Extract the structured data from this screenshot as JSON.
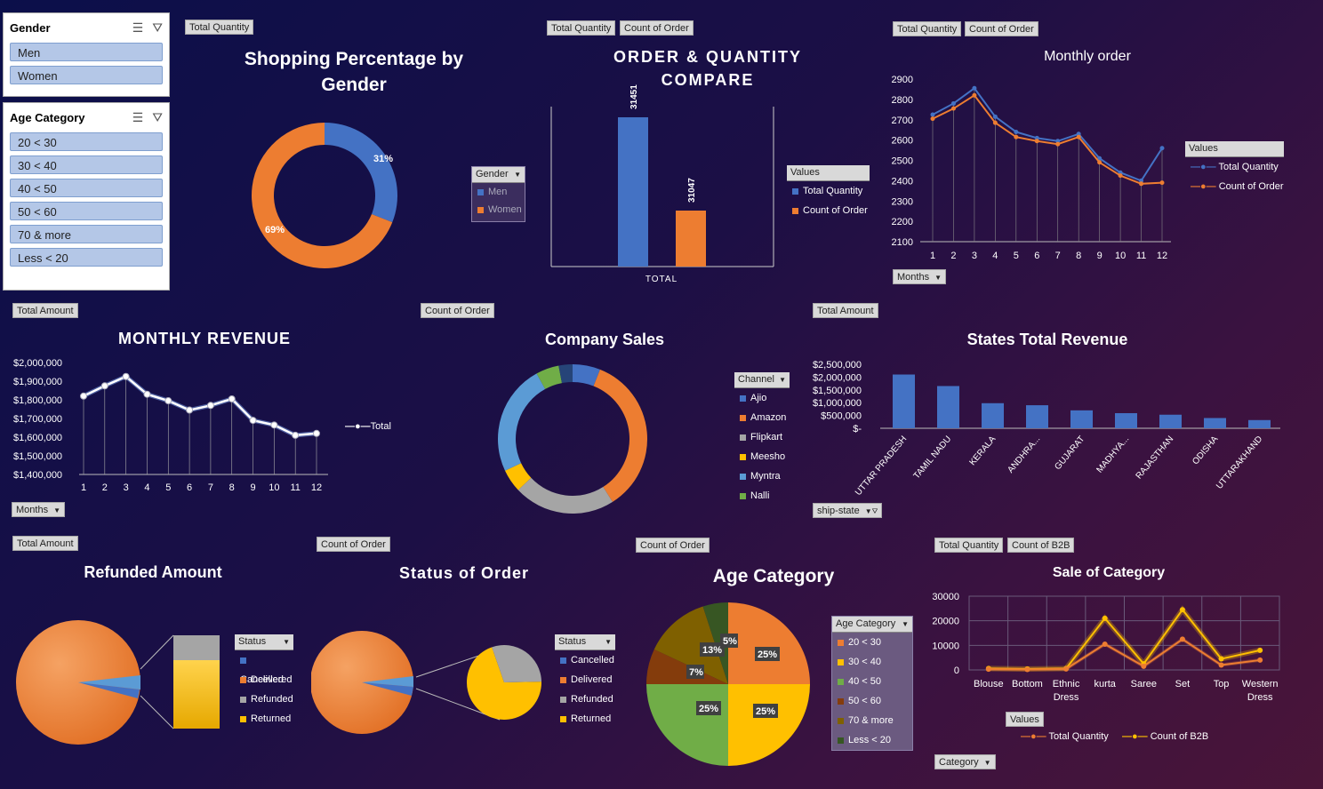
{
  "colors": {
    "blue": "#4472c4",
    "orange": "#ed7d31",
    "gray": "#a5a5a5",
    "yellow": "#ffc000",
    "lightblue": "#5b9bd5",
    "green": "#70ad47",
    "darkgreen": "#375623",
    "brown": "#843c0c",
    "olive": "#7f6000"
  },
  "slicers": {
    "gender": {
      "title": "Gender",
      "items": [
        "Men",
        "Women"
      ]
    },
    "age": {
      "title": "Age Category",
      "items": [
        "20 < 30",
        "30 < 40",
        "40 < 50",
        "50 < 60",
        "70 & more",
        "Less < 20"
      ]
    }
  },
  "gender_chart": {
    "field": "Total Quantity",
    "title_line1": "Shopping Percentage by",
    "title_line2": "Gender",
    "legend_title": "Gender",
    "legend": [
      "Men",
      "Women"
    ],
    "label_men": "31%",
    "label_women": "69%"
  },
  "order_qty": {
    "field1": "Total Quantity",
    "field2": "Count of Order",
    "title_line1": "ORDER & QUANTITY",
    "title_line2": "COMPARE",
    "v1": "31451",
    "v2": "31047",
    "xlabel": "TOTAL",
    "legend_title": "Values",
    "legend": [
      "Total Quantity",
      "Count of Order"
    ]
  },
  "monthly_order": {
    "field1": "Total Quantity",
    "field2": "Count of Order",
    "title": "Monthly order",
    "yticks": [
      "2900",
      "2800",
      "2700",
      "2600",
      "2500",
      "2400",
      "2300",
      "2200",
      "2100"
    ],
    "xticks": [
      "1",
      "2",
      "3",
      "4",
      "5",
      "6",
      "7",
      "8",
      "9",
      "10",
      "11",
      "12"
    ],
    "legend_title": "Values",
    "legend": [
      "Total Quantity",
      "Count of Order"
    ],
    "axis_btn": "Months"
  },
  "monthly_revenue": {
    "field": "Total Amount",
    "title": "MONTHLY REVENUE",
    "yticks": [
      "$2,000,000",
      "$1,900,000",
      "$1,800,000",
      "$1,700,000",
      "$1,600,000",
      "$1,500,000",
      "$1,400,000"
    ],
    "xticks": [
      "1",
      "2",
      "3",
      "4",
      "5",
      "6",
      "7",
      "8",
      "9",
      "10",
      "11",
      "12"
    ],
    "legend": "Total",
    "axis_btn": "Months"
  },
  "company_sales": {
    "field": "Count of Order",
    "title": "Company Sales",
    "legend_title": "Channel",
    "legend": [
      "Ajio",
      "Amazon",
      "Flipkart",
      "Meesho",
      "Myntra",
      "Nalli"
    ]
  },
  "states": {
    "field": "Total Amount",
    "title": "States Total Revenue",
    "yticks": [
      "$2,500,000",
      "$2,000,000",
      "$1,500,000",
      "$1,000,000",
      "$500,000",
      "$-"
    ],
    "categories": [
      "UTTAR PRADESH",
      "TAMIL NADU",
      "KERALA",
      "ANDHRA...",
      "GUJARAT",
      "MADHYA...",
      "RAJASTHAN",
      "ODISHA",
      "UTTARAKHAND"
    ],
    "axis_btn": "ship-state"
  },
  "refunded": {
    "field": "Total Amount",
    "title": "Refunded Amount",
    "legend_title": "Status",
    "legend": [
      "Cancelled",
      "Delivered",
      "Refunded",
      "Returned"
    ]
  },
  "status_order": {
    "field": "Count of Order",
    "title": "Status of Order",
    "legend_title": "Status",
    "legend": [
      "Cancelled",
      "Delivered",
      "Refunded",
      "Returned"
    ]
  },
  "age_chart": {
    "field": "Count of Order",
    "title": "Age Category",
    "labels": [
      "25%",
      "25%",
      "25%",
      "7%",
      "13%",
      "5%"
    ],
    "legend_title": "Age Category",
    "legend": [
      "20 < 30",
      "30 < 40",
      "40 < 50",
      "50 < 60",
      "70 & more",
      "Less < 20"
    ]
  },
  "sale_category": {
    "field1": "Total Quantity",
    "field2": "Count of B2B",
    "title": "Sale of Category",
    "yticks": [
      "30000",
      "20000",
      "10000",
      "0"
    ],
    "categories": [
      "Blouse",
      "Bottom",
      "Ethnic Dress",
      "kurta",
      "Saree",
      "Set",
      "Top",
      "Western Dress"
    ],
    "legend_title": "Values",
    "legend": [
      "Total Quantity",
      "Count of B2B"
    ],
    "axis_btn": "Category"
  },
  "chart_data": [
    {
      "type": "pie",
      "title": "Shopping Percentage by Gender",
      "categories": [
        "Men",
        "Women"
      ],
      "values": [
        31,
        69
      ]
    },
    {
      "type": "bar",
      "title": "ORDER & QUANTITY COMPARE",
      "categories": [
        "TOTAL"
      ],
      "series": [
        {
          "name": "Total Quantity",
          "values": [
            31451
          ]
        },
        {
          "name": "Count of Order",
          "values": [
            31047
          ]
        }
      ],
      "ylim": [
        0,
        38000
      ]
    },
    {
      "type": "line",
      "title": "Monthly order",
      "x": [
        1,
        2,
        3,
        4,
        5,
        6,
        7,
        8,
        9,
        10,
        11,
        12
      ],
      "series": [
        {
          "name": "Total Quantity",
          "values": [
            2725,
            2780,
            2855,
            2715,
            2640,
            2610,
            2595,
            2630,
            2510,
            2440,
            2400,
            2560
          ]
        },
        {
          "name": "Count of Order",
          "values": [
            2705,
            2755,
            2820,
            2685,
            2615,
            2595,
            2580,
            2615,
            2490,
            2425,
            2385,
            2390
          ]
        }
      ],
      "ylim": [
        2100,
        2900
      ]
    },
    {
      "type": "line",
      "title": "MONTHLY REVENUE",
      "x": [
        1,
        2,
        3,
        4,
        5,
        6,
        7,
        8,
        9,
        10,
        11,
        12
      ],
      "series": [
        {
          "name": "Total",
          "values": [
            1820000,
            1875000,
            1925000,
            1830000,
            1795000,
            1745000,
            1770000,
            1805000,
            1690000,
            1665000,
            1610000,
            1620000
          ]
        }
      ],
      "ylim": [
        1400000,
        2000000
      ]
    },
    {
      "type": "pie",
      "title": "Company Sales",
      "categories": [
        "Ajio",
        "Amazon",
        "Flipkart",
        "Meesho",
        "Myntra",
        "Nalli"
      ],
      "values": [
        6,
        35,
        22,
        5,
        24,
        5
      ]
    },
    {
      "type": "bar",
      "title": "States Total Revenue",
      "categories": [
        "UTTAR PRADESH",
        "TAMIL NADU",
        "KERALA",
        "ANDHRA...",
        "GUJARAT",
        "MADHYA...",
        "RAJASTHAN",
        "ODISHA",
        "UTTARAKHAND"
      ],
      "values": [
        2100000,
        1650000,
        980000,
        900000,
        700000,
        590000,
        530000,
        400000,
        320000
      ],
      "ylim": [
        0,
        2500000
      ]
    },
    {
      "type": "pie",
      "title": "Refunded Amount",
      "categories": [
        "Cancelled",
        "Delivered",
        "Refunded",
        "Returned"
      ],
      "values": [
        3,
        94,
        2,
        1
      ]
    },
    {
      "type": "pie",
      "title": "Status of Order",
      "categories": [
        "Cancelled",
        "Delivered",
        "Refunded",
        "Returned"
      ],
      "values": [
        4,
        92,
        2,
        2
      ]
    },
    {
      "type": "pie",
      "title": "Age Category",
      "categories": [
        "20 < 30",
        "30 < 40",
        "40 < 50",
        "50 < 60",
        "70 & more",
        "Less < 20"
      ],
      "values": [
        25,
        25,
        25,
        7,
        13,
        5
      ]
    },
    {
      "type": "line",
      "title": "Sale of Category",
      "categories": [
        "Blouse",
        "Bottom",
        "Ethnic Dress",
        "kurta",
        "Saree",
        "Set",
        "Top",
        "Western Dress"
      ],
      "series": [
        {
          "name": "Total Quantity",
          "values": [
            300,
            200,
            400,
            10500,
            1500,
            12500,
            2000,
            4000
          ]
        },
        {
          "name": "Count of B2B",
          "values": [
            600,
            400,
            600,
            21000,
            2500,
            24500,
            4500,
            8000
          ]
        }
      ],
      "ylim": [
        0,
        30000
      ]
    }
  ]
}
